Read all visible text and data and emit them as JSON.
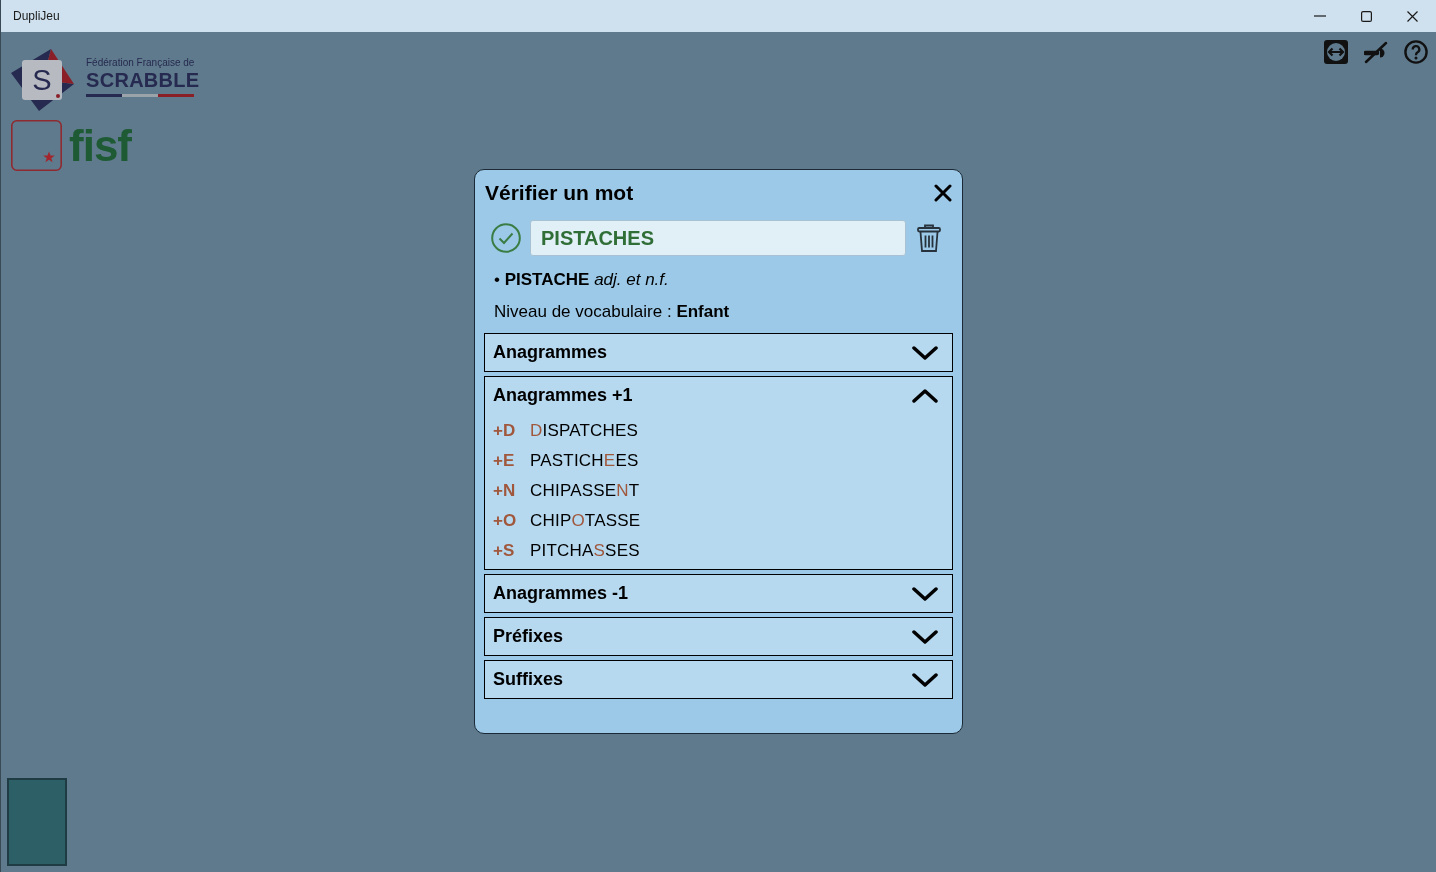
{
  "window": {
    "title": "DupliJeu"
  },
  "logos": {
    "federation": {
      "tile_letter": "S",
      "caption": "Fédération Française de",
      "name": "SCRABBLE"
    },
    "fisf": {
      "text": "fisf"
    }
  },
  "dialog": {
    "title": "Vérifier un mot",
    "search": {
      "value": "PISTACHES",
      "valid": true
    },
    "definition": "• **PISTACHE** *adj. et n.f.*",
    "vocabulary": "Niveau de vocabulaire : **Enfant**",
    "sections": [
      {
        "title": "Anagrammes",
        "expanded": false
      },
      {
        "title": "Anagrammes +1",
        "expanded": true,
        "items": [
          {
            "added": "+D",
            "letter": "D",
            "after": "ISPATCHES"
          },
          {
            "added": "+E",
            "before": "PASTICH",
            "letter": "E",
            "after": "ES"
          },
          {
            "added": "+N",
            "before": "CHIPASSE",
            "letter": "N",
            "after": "T"
          },
          {
            "added": "+O",
            "before": "CHIP",
            "letter": "O",
            "after": "TASSE"
          },
          {
            "added": "+S",
            "before": "PITCHA",
            "letter": "S",
            "after": "SES"
          }
        ]
      },
      {
        "title": "Anagrammes -1",
        "expanded": false
      },
      {
        "title": "Préfixes",
        "expanded": false
      },
      {
        "title": "Suffixes",
        "expanded": false
      }
    ]
  }
}
